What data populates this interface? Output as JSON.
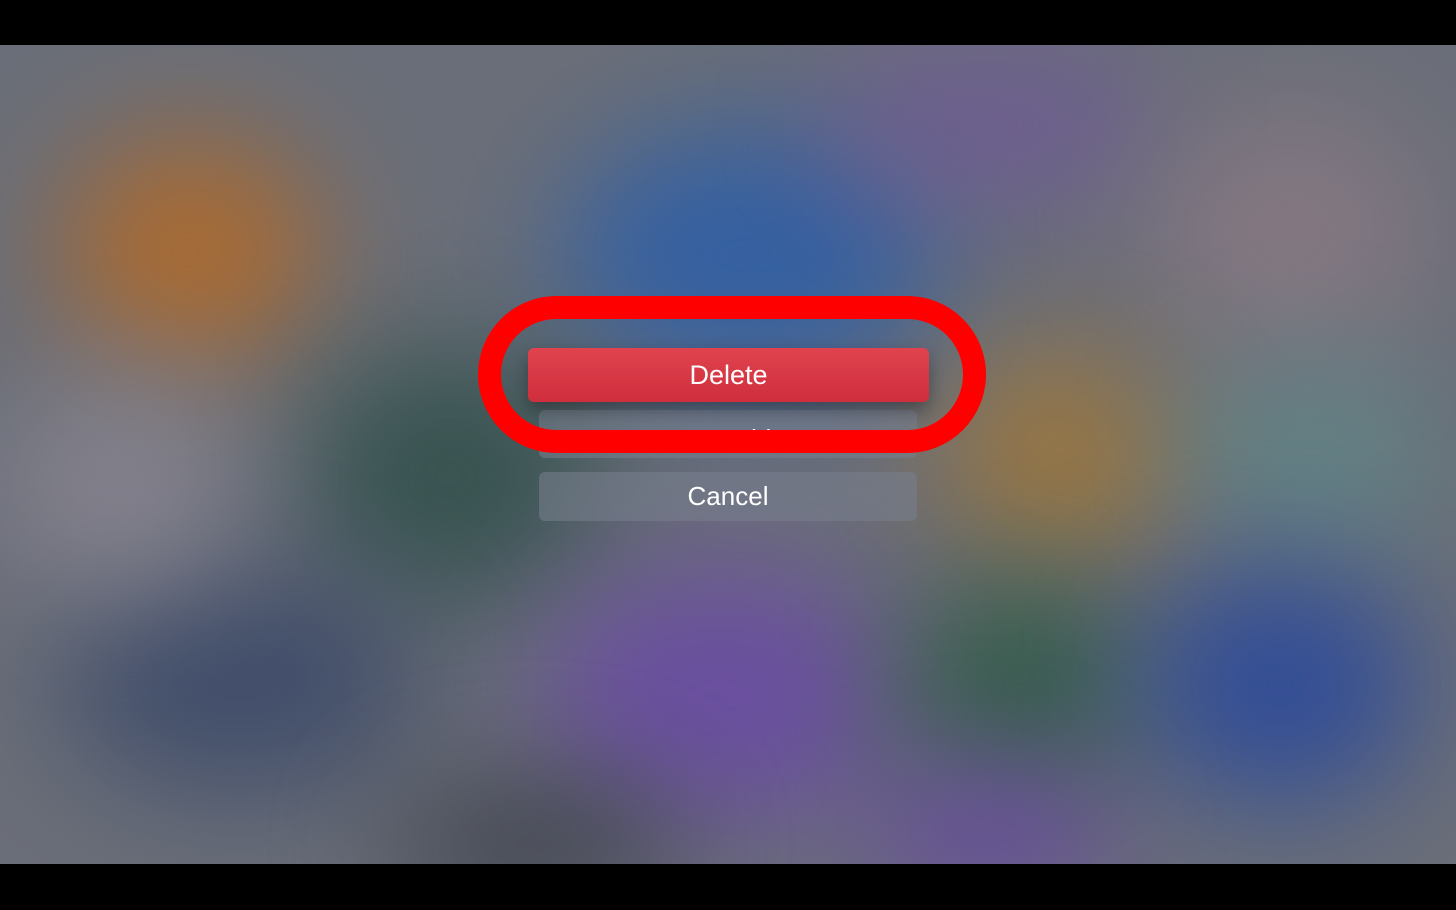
{
  "menu": {
    "delete_label": "Delete",
    "new_folder_label": "New Folder",
    "cancel_label": "Cancel"
  },
  "colors": {
    "delete_button": "#d8363f",
    "highlight_ring": "#ff0000",
    "secondary_button": "#7a808e"
  }
}
